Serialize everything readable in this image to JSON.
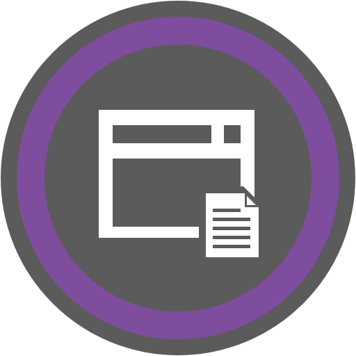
{
  "icon": {
    "name": "window-with-document-icon",
    "colors": {
      "outer_ring": "#5b5b5b",
      "accent_ring": "#7e4d9e",
      "inner_disc": "#5b5b5b",
      "glyph": "#ffffff",
      "glyph_cutout": "#5b5b5b"
    }
  }
}
